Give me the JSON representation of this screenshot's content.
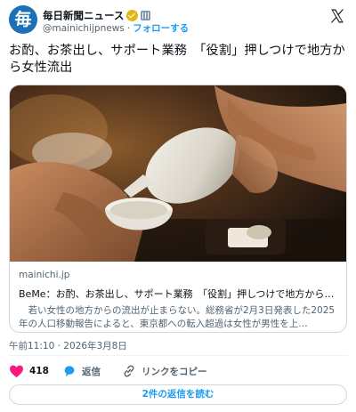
{
  "account": {
    "avatar_glyph": "毎",
    "display_name": "毎日新聞ニュース",
    "handle": "@mainichijpnews",
    "separator": "·",
    "follow_label": "フォローする"
  },
  "tweet": {
    "text": "お酌、お茶出し、サポート業務　「役割」押しつけで地方から女性流出",
    "timestamp": "午前11:10 · 2026年3月8日"
  },
  "card": {
    "domain": "mainichi.jp",
    "title": "BeMe：お酌、お茶出し、サポート業務　「役割」押しつけで地方から…",
    "description": "　若い女性の地方からの流出が止まらない。総務省が2月3日発表した2025年の人口移動報告によると、東京都への転入超過は女性が男性を上…"
  },
  "actions": {
    "like_count": "418",
    "reply_label": "返信",
    "copy_link_label": "リンクをコピー"
  },
  "read_replies_label": "2件の返信を読む",
  "colors": {
    "accent": "#1d9bf0",
    "like": "#f91880",
    "avatar_bg": "#1d6fb8",
    "verified_gold": "#e2b719"
  },
  "icons": [
    "verified-badge-icon",
    "affiliate-building-icon",
    "x-logo-icon",
    "heart-icon",
    "reply-bubble-icon",
    "link-icon"
  ]
}
